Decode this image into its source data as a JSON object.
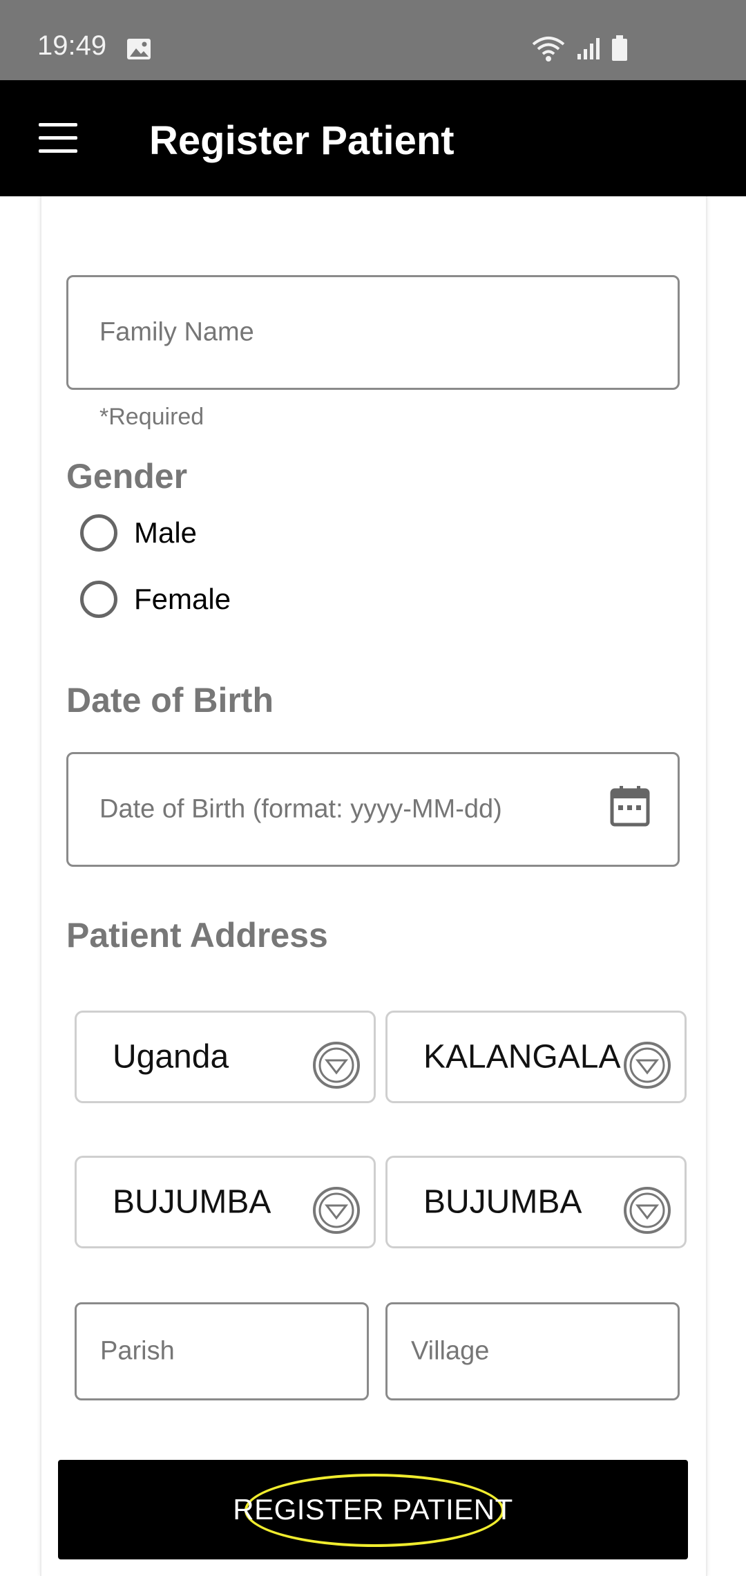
{
  "status_bar": {
    "time": "19:49"
  },
  "app_bar": {
    "title": "Register Patient"
  },
  "form": {
    "family_name_placeholder": "Family Name",
    "required_helper": "*Required",
    "gender_label": "Gender",
    "gender_options": [
      "Male",
      "Female"
    ],
    "dob_label": "Date of Birth",
    "dob_placeholder": "Date of Birth (format: yyyy-MM-dd)",
    "address_label": "Patient Address",
    "country": "Uganda",
    "district": "KALANGALA",
    "subcounty": "BUJUMBA",
    "county": "BUJUMBA",
    "parish_placeholder": "Parish",
    "village_placeholder": "Village"
  },
  "actions": {
    "register_label": "REGISTER PATIENT"
  },
  "colors": {
    "app_bar": "#000000",
    "status_bar": "#777777",
    "highlight": "#f0ec2e"
  }
}
